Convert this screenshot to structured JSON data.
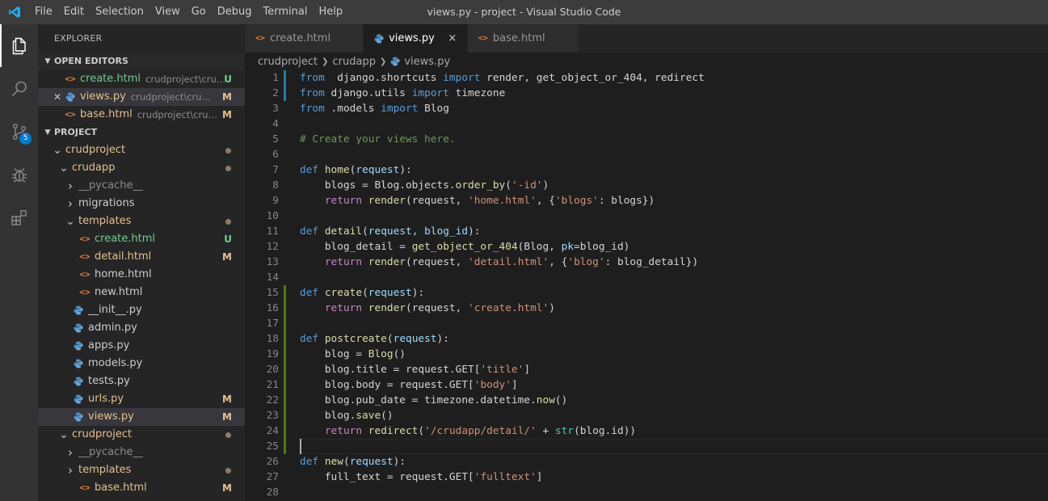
{
  "window": {
    "title": "views.py - project - Visual Studio Code"
  },
  "menu": [
    "File",
    "Edit",
    "Selection",
    "View",
    "Go",
    "Debug",
    "Terminal",
    "Help"
  ],
  "activity_bar": {
    "icons": [
      "files-icon",
      "search-icon",
      "source-control-icon",
      "debug-icon",
      "extensions-icon"
    ],
    "source_control_badge": "5"
  },
  "sidebar": {
    "title": "EXPLORER",
    "open_editors": {
      "header": "OPEN EDITORS",
      "items": [
        {
          "name": "create.html",
          "path": "crudproject\\crud...",
          "status": "U",
          "color": "#73c991"
        },
        {
          "name": "views.py",
          "path": "crudproject\\crudapp",
          "status": "M",
          "color": "#e2c08d"
        },
        {
          "name": "base.html",
          "path": "crudproject\\crudp...",
          "status": "M",
          "color": "#e2c08d"
        }
      ]
    },
    "project": {
      "header": "PROJECT",
      "tree": [
        {
          "label": "crudproject",
          "depth": 1,
          "type": "folder",
          "open": true,
          "dot": true,
          "color": "#e2c08d"
        },
        {
          "label": "crudapp",
          "depth": 2,
          "type": "folder",
          "open": true,
          "dot": true,
          "color": "#e2c08d"
        },
        {
          "label": "__pycache__",
          "depth": 3,
          "type": "folder",
          "open": false,
          "color": "#8c8c8c"
        },
        {
          "label": "migrations",
          "depth": 3,
          "type": "folder",
          "open": false,
          "color": "#cccccc"
        },
        {
          "label": "templates",
          "depth": 3,
          "type": "folder",
          "open": true,
          "dot": true,
          "color": "#e2c08d"
        },
        {
          "label": "create.html",
          "depth": 4,
          "type": "html",
          "status": "U",
          "color": "#73c991"
        },
        {
          "label": "detail.html",
          "depth": 4,
          "type": "html",
          "status": "M",
          "color": "#e2c08d"
        },
        {
          "label": "home.html",
          "depth": 4,
          "type": "html",
          "color": "#cccccc"
        },
        {
          "label": "new.html",
          "depth": 4,
          "type": "html",
          "color": "#cccccc"
        },
        {
          "label": "__init__.py",
          "depth": 3,
          "type": "py",
          "color": "#cccccc"
        },
        {
          "label": "admin.py",
          "depth": 3,
          "type": "py",
          "color": "#cccccc"
        },
        {
          "label": "apps.py",
          "depth": 3,
          "type": "py",
          "color": "#cccccc"
        },
        {
          "label": "models.py",
          "depth": 3,
          "type": "py",
          "color": "#cccccc"
        },
        {
          "label": "tests.py",
          "depth": 3,
          "type": "py",
          "color": "#cccccc"
        },
        {
          "label": "urls.py",
          "depth": 3,
          "type": "py",
          "status": "M",
          "color": "#e2c08d"
        },
        {
          "label": "views.py",
          "depth": 3,
          "type": "py",
          "status": "M",
          "color": "#e2c08d",
          "selected": true
        },
        {
          "label": "crudproject",
          "depth": 2,
          "type": "folder",
          "open": true,
          "dot": true,
          "color": "#e2c08d"
        },
        {
          "label": "__pycache__",
          "depth": 3,
          "type": "folder",
          "open": false,
          "color": "#8c8c8c"
        },
        {
          "label": "templates",
          "depth": 3,
          "type": "folder",
          "open": false,
          "dot": true,
          "color": "#e2c08d"
        },
        {
          "label": "base.html",
          "depth": 4,
          "type": "html",
          "status": "M",
          "color": "#e2c08d"
        }
      ]
    }
  },
  "tabs": [
    {
      "label": "create.html",
      "type": "html",
      "active": false
    },
    {
      "label": "views.py",
      "type": "py",
      "active": true,
      "close": "×"
    },
    {
      "label": "base.html",
      "type": "html",
      "active": false
    }
  ],
  "breadcrumb": [
    "crudproject",
    "crudapp",
    "views.py"
  ],
  "editor": {
    "cursor_line": 25,
    "lines": [
      {
        "n": "1",
        "gutter": "mod",
        "tokens": [
          [
            "kw",
            "from"
          ],
          [
            "",
            "  django.shortcuts "
          ],
          [
            "kw",
            "import"
          ],
          [
            "",
            " render, get_object_or_404, redirect"
          ]
        ]
      },
      {
        "n": "2",
        "gutter": "mod",
        "tokens": [
          [
            "kw",
            "from"
          ],
          [
            "",
            " django.utils "
          ],
          [
            "kw",
            "import"
          ],
          [
            "",
            " timezone"
          ]
        ]
      },
      {
        "n": "3",
        "tokens": [
          [
            "kw",
            "from"
          ],
          [
            "",
            " .models "
          ],
          [
            "kw",
            "import"
          ],
          [
            "",
            " Blog"
          ]
        ]
      },
      {
        "n": "4",
        "tokens": []
      },
      {
        "n": "5",
        "tokens": [
          [
            "cm",
            "# Create your views here."
          ]
        ]
      },
      {
        "n": "6",
        "tokens": []
      },
      {
        "n": "7",
        "tokens": [
          [
            "kw",
            "def"
          ],
          [
            "",
            " "
          ],
          [
            "fn",
            "home"
          ],
          [
            "",
            "("
          ],
          [
            "par",
            "request"
          ],
          [
            "",
            "):"
          ]
        ]
      },
      {
        "n": "8",
        "tokens": [
          [
            "",
            "    blogs = Blog.objects."
          ],
          [
            "fn",
            "order_by"
          ],
          [
            "",
            "("
          ],
          [
            "str",
            "'-id'"
          ],
          [
            "",
            ")"
          ]
        ]
      },
      {
        "n": "9",
        "tokens": [
          [
            "",
            "    "
          ],
          [
            "ctl",
            "return"
          ],
          [
            "",
            " "
          ],
          [
            "fn",
            "render"
          ],
          [
            "",
            "(request, "
          ],
          [
            "str",
            "'home.html'"
          ],
          [
            "",
            ", {"
          ],
          [
            "str",
            "'blogs'"
          ],
          [
            "",
            ": blogs})"
          ]
        ]
      },
      {
        "n": "10",
        "tokens": []
      },
      {
        "n": "11",
        "tokens": [
          [
            "kw",
            "def"
          ],
          [
            "",
            " "
          ],
          [
            "fn",
            "detail"
          ],
          [
            "",
            "("
          ],
          [
            "par",
            "request"
          ],
          [
            "",
            ", "
          ],
          [
            "par",
            "blog_id"
          ],
          [
            "",
            "):"
          ]
        ]
      },
      {
        "n": "12",
        "tokens": [
          [
            "",
            "    blog_detail = "
          ],
          [
            "fn",
            "get_object_or_404"
          ],
          [
            "",
            "(Blog, "
          ],
          [
            "par",
            "pk"
          ],
          [
            "",
            "=blog_id)"
          ]
        ]
      },
      {
        "n": "13",
        "tokens": [
          [
            "",
            "    "
          ],
          [
            "ctl",
            "return"
          ],
          [
            "",
            " "
          ],
          [
            "fn",
            "render"
          ],
          [
            "",
            "(request, "
          ],
          [
            "str",
            "'detail.html'"
          ],
          [
            "",
            ", {"
          ],
          [
            "str",
            "'blog'"
          ],
          [
            "",
            ": blog_detail})"
          ]
        ]
      },
      {
        "n": "14",
        "tokens": []
      },
      {
        "n": "15",
        "gutter": "add",
        "tokens": [
          [
            "kw",
            "def"
          ],
          [
            "",
            " "
          ],
          [
            "fn",
            "create"
          ],
          [
            "",
            "("
          ],
          [
            "par",
            "request"
          ],
          [
            "",
            "):"
          ]
        ]
      },
      {
        "n": "16",
        "gutter": "add",
        "tokens": [
          [
            "",
            "    "
          ],
          [
            "ctl",
            "return"
          ],
          [
            "",
            " "
          ],
          [
            "fn",
            "render"
          ],
          [
            "",
            "(request, "
          ],
          [
            "str",
            "'create.html'"
          ],
          [
            "",
            ")"
          ]
        ]
      },
      {
        "n": "17",
        "gutter": "add",
        "tokens": []
      },
      {
        "n": "18",
        "gutter": "add",
        "tokens": [
          [
            "kw",
            "def"
          ],
          [
            "",
            " "
          ],
          [
            "fn",
            "postcreate"
          ],
          [
            "",
            "("
          ],
          [
            "par",
            "request"
          ],
          [
            "",
            "):"
          ]
        ]
      },
      {
        "n": "19",
        "gutter": "add",
        "tokens": [
          [
            "",
            "    blog = "
          ],
          [
            "fn",
            "Blog"
          ],
          [
            "",
            "()"
          ]
        ]
      },
      {
        "n": "20",
        "gutter": "add",
        "tokens": [
          [
            "",
            "    blog.title = request.GET["
          ],
          [
            "str",
            "'title'"
          ],
          [
            "",
            "]"
          ]
        ]
      },
      {
        "n": "21",
        "gutter": "add",
        "tokens": [
          [
            "",
            "    blog.body = request.GET["
          ],
          [
            "str",
            "'body'"
          ],
          [
            "",
            "]"
          ]
        ]
      },
      {
        "n": "22",
        "gutter": "add",
        "tokens": [
          [
            "",
            "    blog.pub_date = timezone.datetime."
          ],
          [
            "fn",
            "now"
          ],
          [
            "",
            "()"
          ]
        ]
      },
      {
        "n": "23",
        "gutter": "add",
        "tokens": [
          [
            "",
            "    blog."
          ],
          [
            "fn",
            "save"
          ],
          [
            "",
            "()"
          ]
        ]
      },
      {
        "n": "24",
        "gutter": "add",
        "tokens": [
          [
            "",
            "    "
          ],
          [
            "ctl",
            "return"
          ],
          [
            "",
            " "
          ],
          [
            "fn",
            "redirect"
          ],
          [
            "",
            "("
          ],
          [
            "str",
            "'/crudapp/detail/'"
          ],
          [
            "",
            " + "
          ],
          [
            "bi",
            "str"
          ],
          [
            "",
            "(blog.id))"
          ]
        ]
      },
      {
        "n": "25",
        "gutter": "add",
        "tokens": []
      },
      {
        "n": "26",
        "tokens": [
          [
            "kw",
            "def"
          ],
          [
            "",
            " "
          ],
          [
            "fn",
            "new"
          ],
          [
            "",
            "("
          ],
          [
            "par",
            "request"
          ],
          [
            "",
            "):"
          ]
        ]
      },
      {
        "n": "27",
        "tokens": [
          [
            "",
            "    full_text = request.GET["
          ],
          [
            "str",
            "'fulltext'"
          ],
          [
            "",
            "]"
          ]
        ]
      },
      {
        "n": "28",
        "tokens": []
      }
    ]
  }
}
